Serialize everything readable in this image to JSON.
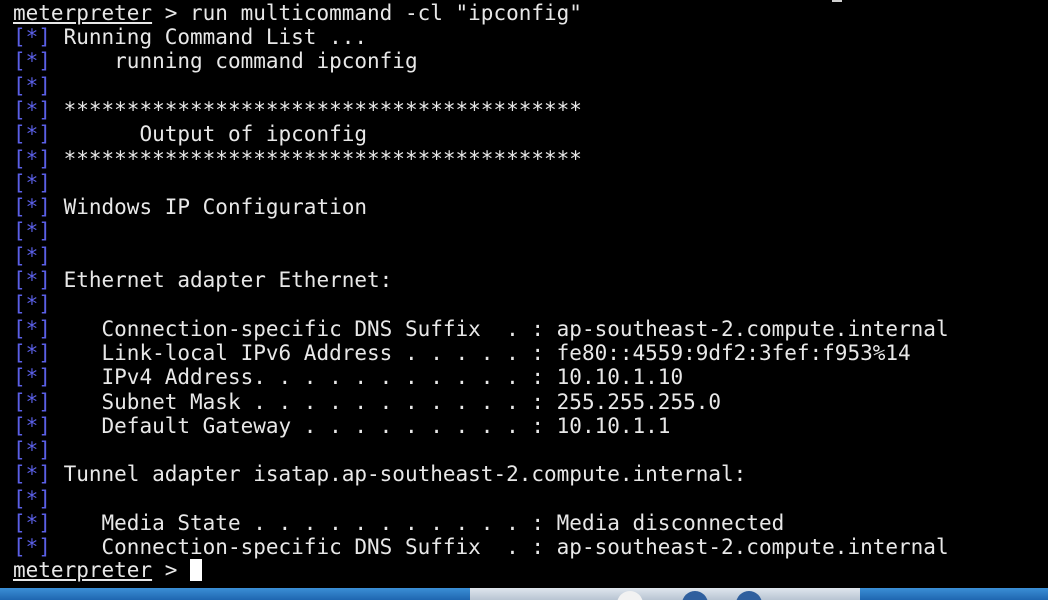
{
  "prompt": "meterpreter",
  "command_line": " > run multicommand -cl \"ipconfig\"",
  "final_prompt_suffix": " > ",
  "tag": "[*]",
  "lines": [
    " Running Command List ...",
    "     running command ipconfig",
    "",
    " *****************************************",
    "       Output of ipconfig",
    " *****************************************",
    "",
    " Windows IP Configuration",
    "",
    "",
    " Ethernet adapter Ethernet:",
    "",
    "    Connection-specific DNS Suffix  . : ap-southeast-2.compute.internal",
    "    Link-local IPv6 Address . . . . . : fe80::4559:9df2:3fef:f953%14",
    "    IPv4 Address. . . . . . . . . . . : 10.10.1.10",
    "    Subnet Mask . . . . . . . . . . . : 255.255.255.0",
    "    Default Gateway . . . . . . . . . : 10.10.1.1",
    "",
    " Tunnel adapter isatap.ap-southeast-2.compute.internal:",
    "",
    "    Media State . . . . . . . . . . . : Media disconnected",
    "    Connection-specific DNS Suffix  . : ap-southeast-2.compute.internal"
  ],
  "colors": {
    "background": "#000000",
    "text": "#e8e8e8",
    "tag": "#5a5fe6",
    "cursor": "#ffffff"
  }
}
